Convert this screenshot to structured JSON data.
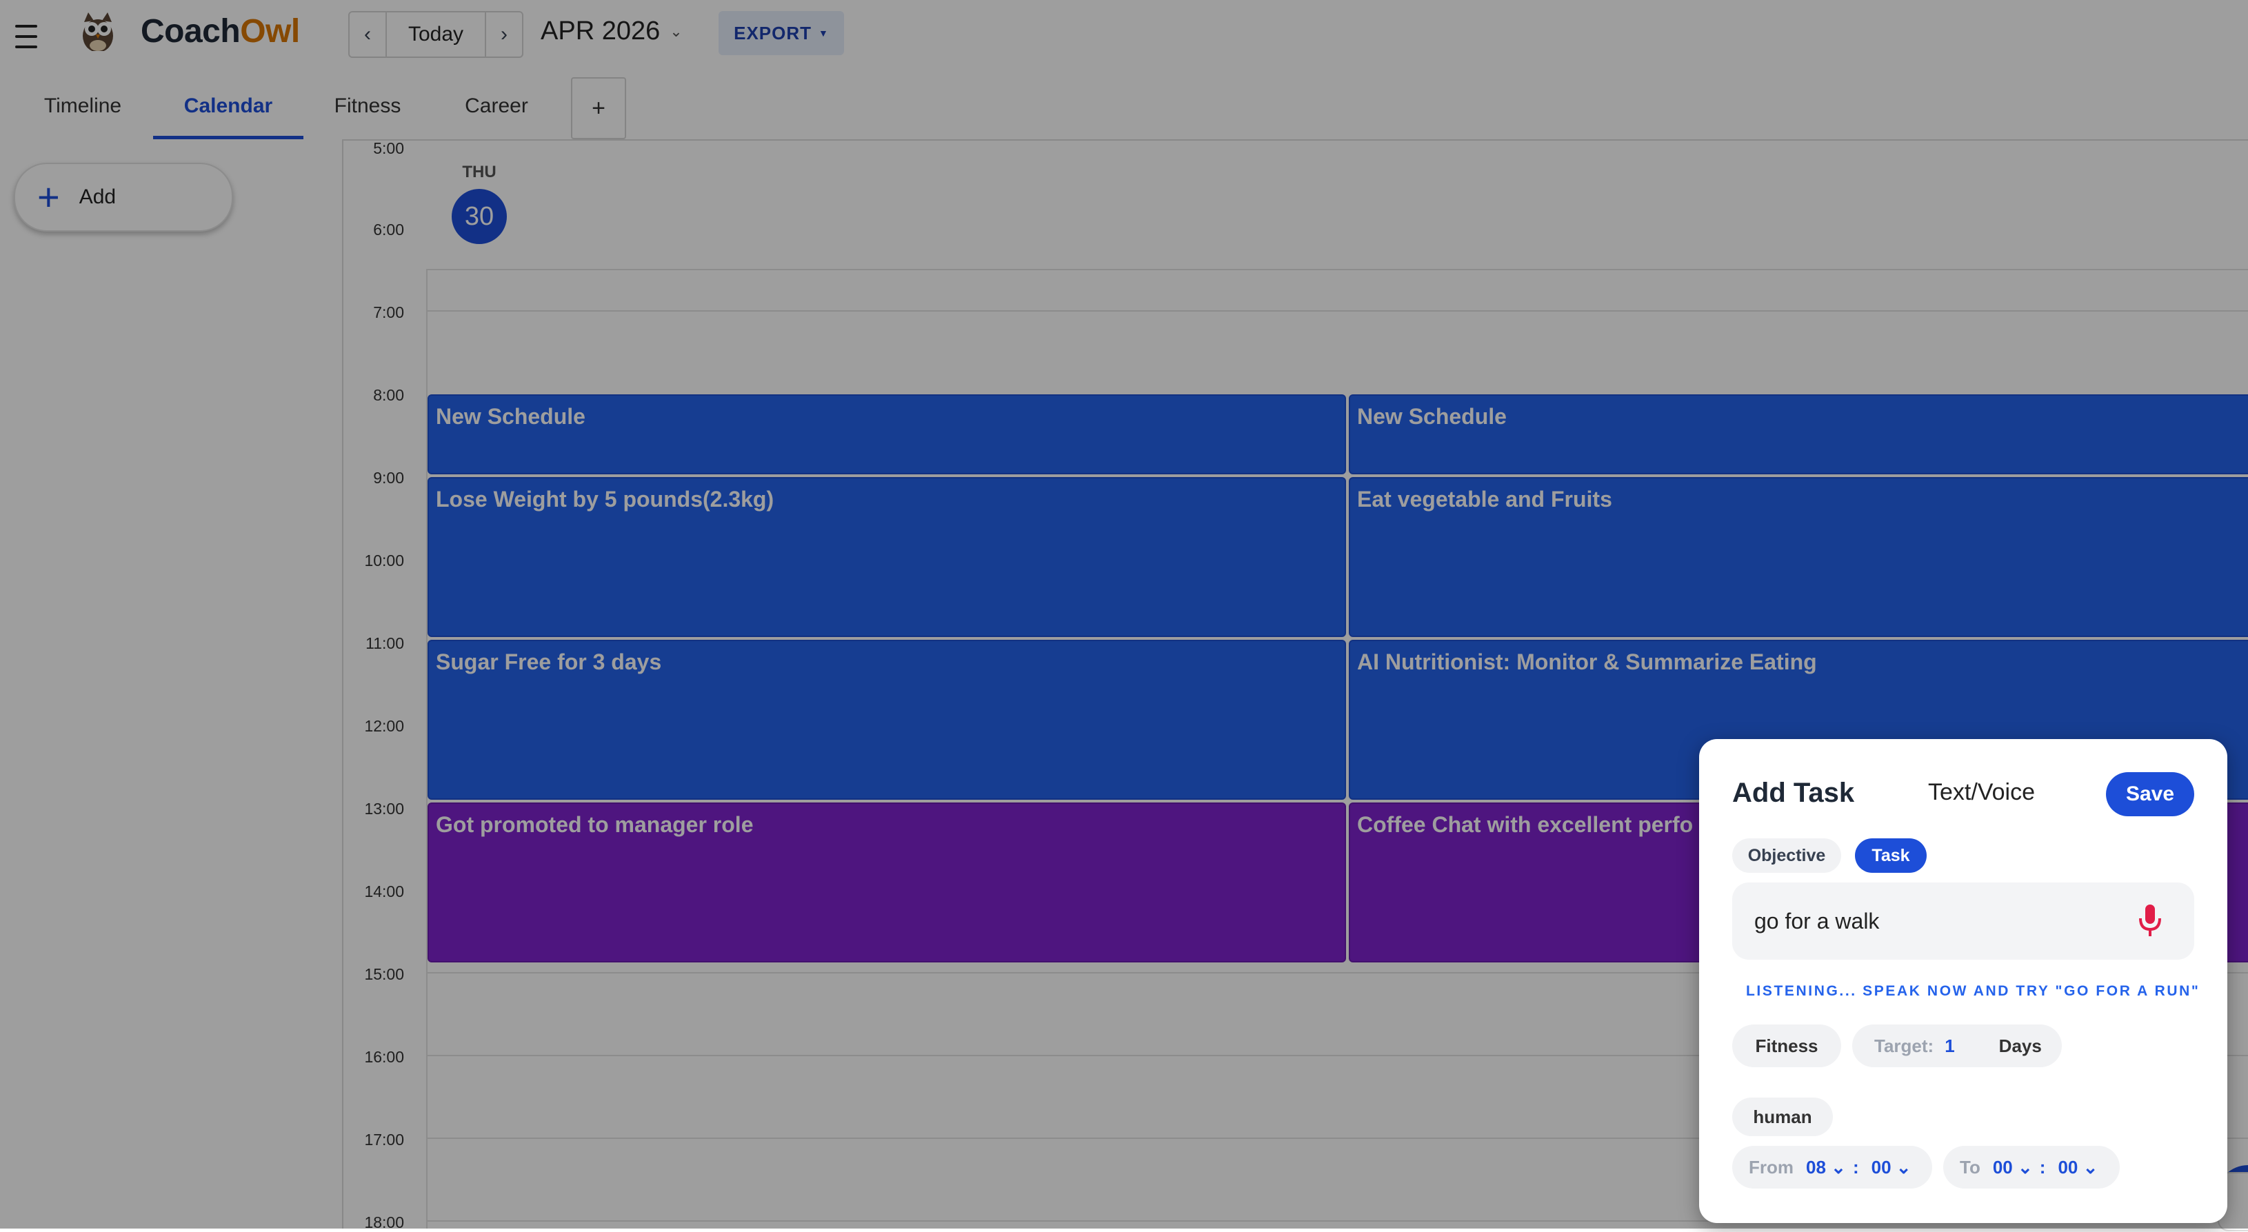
{
  "header": {
    "brand_a": "Coach",
    "brand_b": "Owl",
    "today_label": "Today",
    "month_label": "APR 2026",
    "export_label": "EXPORT"
  },
  "tabs": [
    {
      "label": "Timeline"
    },
    {
      "label": "Calendar"
    },
    {
      "label": "Fitness"
    },
    {
      "label": "Career"
    }
  ],
  "tab_add_label": "+",
  "sidebar": {
    "add_label": "Add"
  },
  "day": {
    "dow": "THU",
    "num": "30"
  },
  "times": [
    "5:00",
    "6:00",
    "7:00",
    "8:00",
    "9:00",
    "10:00",
    "11:00",
    "12:00",
    "13:00",
    "14:00",
    "15:00",
    "16:00",
    "17:00",
    "18:00"
  ],
  "events": [
    {
      "title": "New Schedule",
      "color": "blue"
    },
    {
      "title": "New Schedule",
      "color": "blue"
    },
    {
      "title": "Lose Weight by 5 pounds(2.3kg)",
      "color": "blue"
    },
    {
      "title": "Eat vegetable and Fruits",
      "color": "blue"
    },
    {
      "title": "Sugar Free for 3 days",
      "color": "blue"
    },
    {
      "title": "AI Nutritionist: Monitor & Summarize Eating",
      "color": "blue"
    },
    {
      "title": "Got promoted to manager role",
      "color": "purple"
    },
    {
      "title": "Coffee Chat with excellent perfo",
      "color": "purple"
    }
  ],
  "modal": {
    "title": "Add Task",
    "mode": "Text/Voice",
    "save_label": "Save",
    "type_objective": "Objective",
    "type_task": "Task",
    "input_value": "go for a walk",
    "listening": "LISTENING... SPEAK NOW AND TRY \"GO FOR A RUN\"",
    "category": "Fitness",
    "target_label": "Target:",
    "target_value": "1",
    "target_unit": "Days",
    "tag": "human",
    "from_label": "From",
    "from_h": "08",
    "from_m": "00",
    "to_label": "To",
    "to_h": "00",
    "to_m": "00",
    "colon": ":"
  },
  "colors": {
    "accent": "#1d4ed8",
    "event_blue": "#2563eb",
    "event_purple": "#7e22ce",
    "brand_orange": "#d97706"
  }
}
